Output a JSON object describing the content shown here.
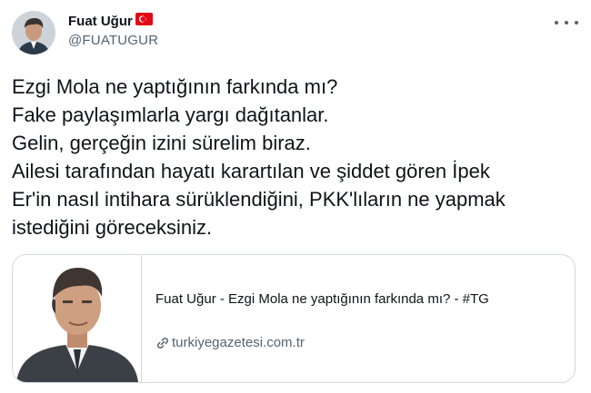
{
  "author": {
    "name": "Fuat Uğur",
    "handle": "@FUATUGUR",
    "flag_icon": "turkey-flag-icon",
    "avatar_icon": "profile-photo"
  },
  "tweet": {
    "lines": [
      "Ezgi Mola ne yaptığının farkında mı?",
      "Fake paylaşımlarla yargı dağıtanlar.",
      "Gelin, gerçeğin izini sürelim biraz.",
      "Ailesi tarafından hayatı karartılan ve şiddet gören İpek",
      "Er'in nasıl intihara sürüklendiğini, PKK'lıların ne yapmak",
      "istediğini göreceksiniz."
    ]
  },
  "card": {
    "title": "Fuat Uğur - Ezgi Mola ne yaptığının farkında mı? - #TG",
    "domain": "turkiyegazetesi.com.tr",
    "link_icon": "link-icon"
  },
  "menu_icon": "more-options-icon",
  "colors": {
    "text": "#0f1419",
    "secondary": "#536471",
    "border": "#cfd9de",
    "flag_red": "#e30a17"
  }
}
